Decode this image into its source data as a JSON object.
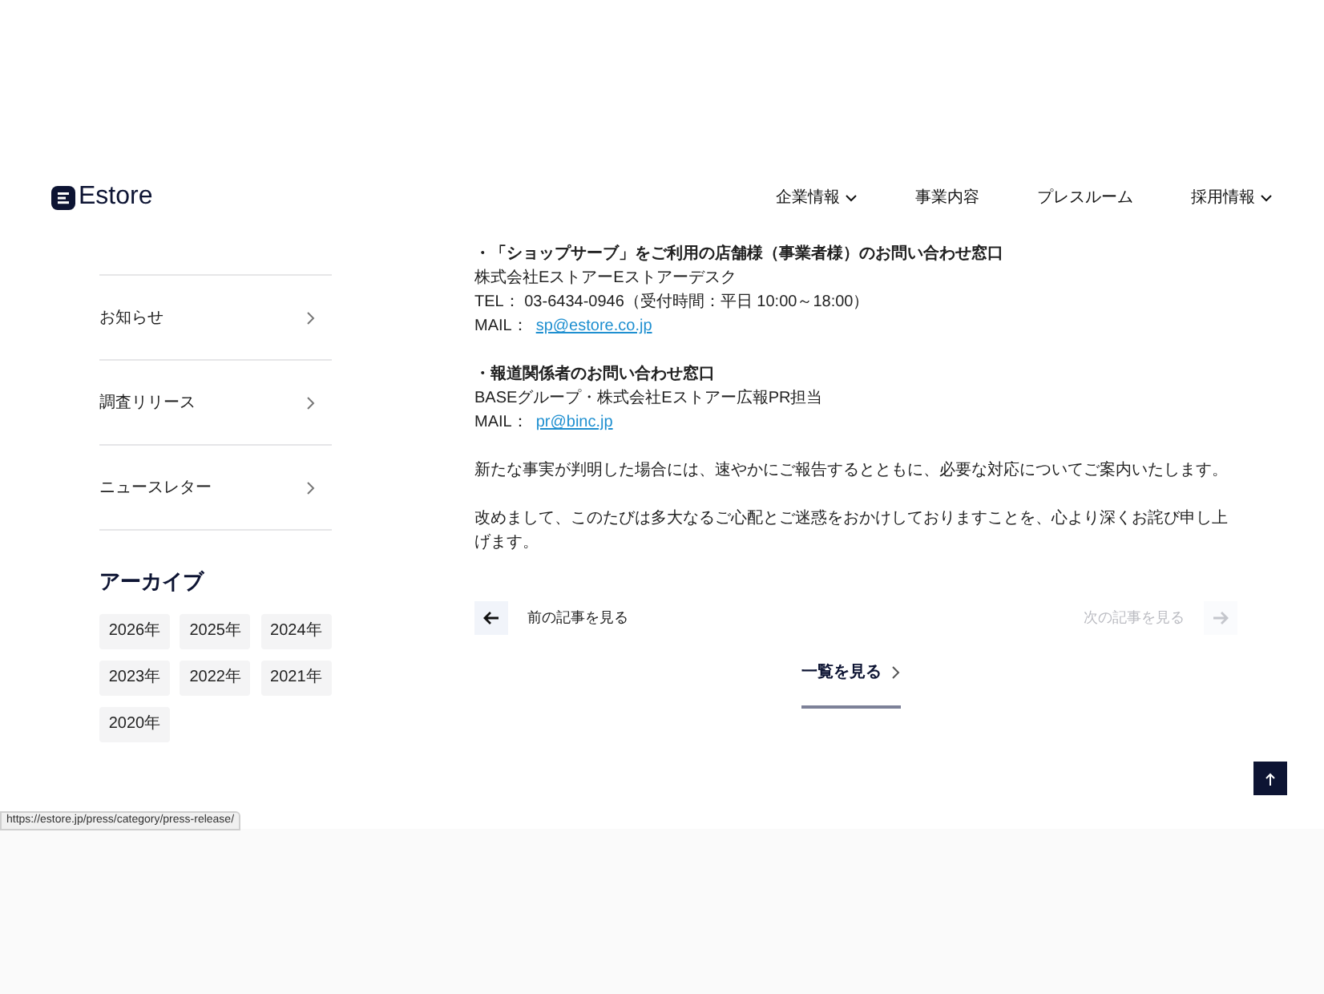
{
  "header": {
    "logo": "Estore",
    "nav": [
      {
        "label": "企業情報",
        "has_menu": true
      },
      {
        "label": "事業内容",
        "has_menu": false
      },
      {
        "label": "プレスルーム",
        "has_menu": false
      },
      {
        "label": "採用情報",
        "has_menu": true
      }
    ]
  },
  "sidebar": {
    "items": [
      {
        "label": "お知らせ"
      },
      {
        "label": "調査リリース"
      },
      {
        "label": "ニュースレター"
      }
    ],
    "archive_title": "アーカイブ",
    "years": [
      "2026年",
      "2025年",
      "2024年",
      "2023年",
      "2022年",
      "2021年",
      "2020年"
    ]
  },
  "article": {
    "blocks": [
      {
        "heading": "・「ショップサーブ」をご利用の店舗様（事業者様）のお問い合わせ窓口",
        "lines": [
          "株式会社EストアーEストアーデスク",
          "TEL： 03-6434-0946（受付時間：平日 10:00～18:00）"
        ],
        "mail_label": "MAIL：",
        "mail": "sp@estore.co.jp"
      },
      {
        "heading": "・報道関係者のお問い合わせ窓口",
        "lines": [
          "BASEグループ・株式会社Eストアー広報PR担当"
        ],
        "mail_label": "MAIL：",
        "mail": "pr@binc.jp"
      }
    ],
    "paragraphs": [
      "新たな事実が判明した場合には、速やかにご報告するとともに、必要な対応についてご案内いたします。",
      "改めまして、このたびは多大なるご心配とご迷惑をおかけしておりますことを、心より深くお詫び申し上げます。"
    ]
  },
  "pager": {
    "prev": {
      "label": "前の記事を見る",
      "disabled": false
    },
    "next": {
      "label": "次の記事を見る",
      "disabled": true
    },
    "list_link": "一覧を見る"
  },
  "status_url": "https://estore.jp/press/category/press-release/"
}
